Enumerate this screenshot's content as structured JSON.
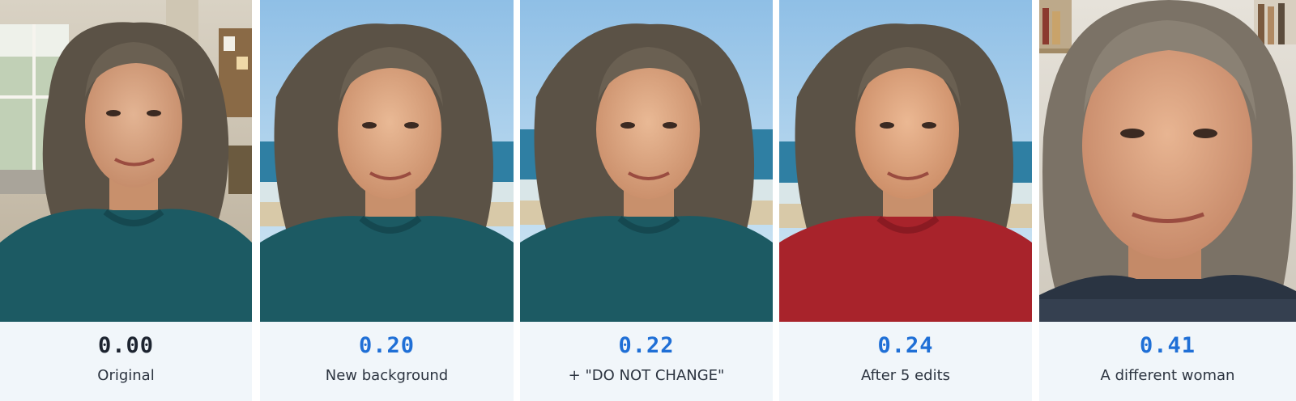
{
  "panels": [
    {
      "score": "0.00",
      "label": "Original",
      "score_color": "#1d2430",
      "scene": "kitchen",
      "sweater_color": "#1c5a63"
    },
    {
      "score": "0.20",
      "label": "New background",
      "score_color": "#1f6fd6",
      "scene": "beach",
      "sweater_color": "#1c5a63"
    },
    {
      "score": "0.22",
      "label": "+ \"DO NOT CHANGE\"",
      "score_color": "#1f6fd6",
      "scene": "beach",
      "sweater_color": "#1c5a63"
    },
    {
      "score": "0.24",
      "label": "After 5 edits",
      "score_color": "#1f6fd6",
      "scene": "beach",
      "sweater_color": "#a8232b"
    },
    {
      "score": "0.41",
      "label": "A different woman",
      "score_color": "#1f6fd6",
      "scene": "bookshelf",
      "sweater_color": "#2a3442"
    }
  ]
}
